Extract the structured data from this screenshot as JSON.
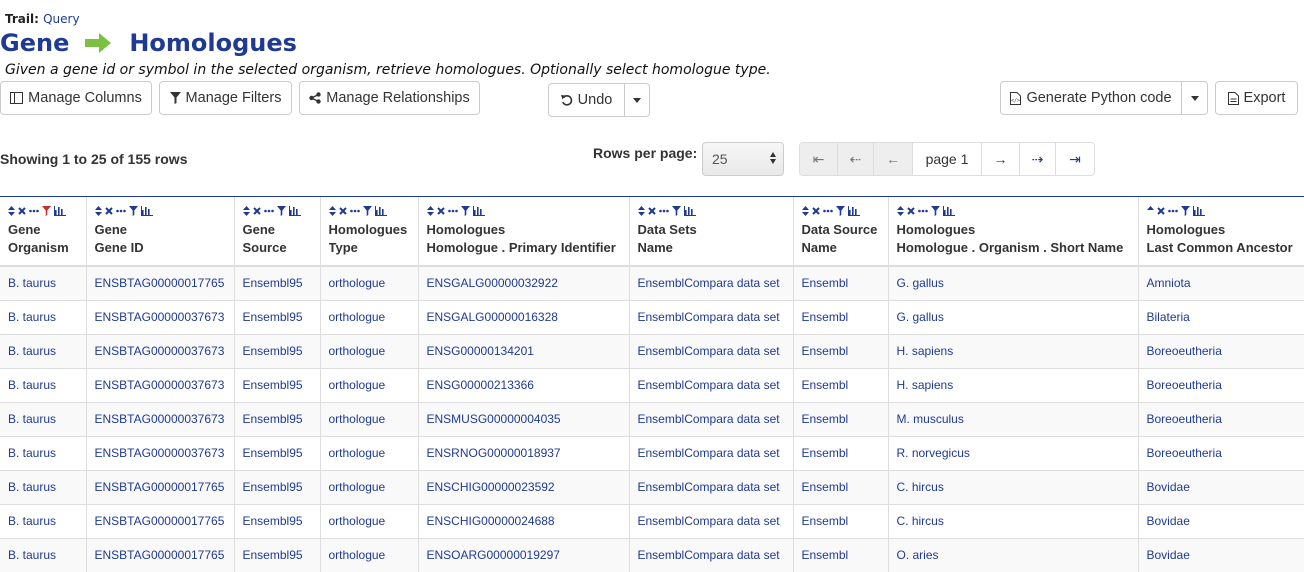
{
  "trail": {
    "label": "Trail:",
    "link": "Query"
  },
  "title": {
    "left": "Gene",
    "right": "Homologues"
  },
  "description": "Given a gene id or symbol in the selected organism, retrieve homologues. Optionally select homologue type.",
  "toolbar": {
    "manage_columns": "Manage Columns",
    "manage_filters": "Manage Filters",
    "manage_relationships": "Manage Relationships",
    "undo": "Undo",
    "generate_code": "Generate Python code",
    "export": "Export"
  },
  "showing": "Showing 1 to 25 of 155 rows",
  "rows_per_page": {
    "label": "Rows per page:",
    "value": "25"
  },
  "pager": {
    "first": "⇤",
    "prev_small": "⇠",
    "prev": "←",
    "page": "page 1",
    "next": "→",
    "next_small": "⇢",
    "last": "⇥"
  },
  "colors": {
    "accent": "#1f3a93",
    "arrow": "#7ac142",
    "filter_active": "#c9302c"
  },
  "columns": [
    {
      "line1": "Gene",
      "line2": "Organism",
      "filter_active": true,
      "sort_icon": "sort"
    },
    {
      "line1": "Gene",
      "line2": "Gene ID",
      "filter_active": false,
      "sort_icon": "sort"
    },
    {
      "line1": "Gene",
      "line2": "Source",
      "filter_active": false,
      "sort_icon": "sort"
    },
    {
      "line1": "Homologues",
      "line2": "Type",
      "filter_active": false,
      "sort_icon": "sort"
    },
    {
      "line1": "Homologues",
      "line2": "Homologue . Primary Identifier",
      "filter_active": false,
      "sort_icon": "sort"
    },
    {
      "line1": "Data Sets",
      "line2": "Name",
      "filter_active": false,
      "sort_icon": "sort"
    },
    {
      "line1": "Data Source",
      "line2": "Name",
      "filter_active": false,
      "sort_icon": "sort"
    },
    {
      "line1": "Homologues",
      "line2": "Homologue . Organism . Short Name",
      "filter_active": false,
      "sort_icon": "sort"
    },
    {
      "line1": "Homologues",
      "line2": "Last Common Ancestor",
      "filter_active": false,
      "sort_icon": "sort-asc"
    }
  ],
  "rows": [
    [
      "B. taurus",
      "ENSBTAG00000017765",
      "Ensembl95",
      "orthologue",
      "ENSGALG00000032922",
      "EnsemblCompara data set",
      "Ensembl",
      "G. gallus",
      "Amniota"
    ],
    [
      "B. taurus",
      "ENSBTAG00000037673",
      "Ensembl95",
      "orthologue",
      "ENSGALG00000016328",
      "EnsemblCompara data set",
      "Ensembl",
      "G. gallus",
      "Bilateria"
    ],
    [
      "B. taurus",
      "ENSBTAG00000037673",
      "Ensembl95",
      "orthologue",
      "ENSG00000134201",
      "EnsemblCompara data set",
      "Ensembl",
      "H. sapiens",
      "Boreoeutheria"
    ],
    [
      "B. taurus",
      "ENSBTAG00000037673",
      "Ensembl95",
      "orthologue",
      "ENSG00000213366",
      "EnsemblCompara data set",
      "Ensembl",
      "H. sapiens",
      "Boreoeutheria"
    ],
    [
      "B. taurus",
      "ENSBTAG00000037673",
      "Ensembl95",
      "orthologue",
      "ENSMUSG00000004035",
      "EnsemblCompara data set",
      "Ensembl",
      "M. musculus",
      "Boreoeutheria"
    ],
    [
      "B. taurus",
      "ENSBTAG00000037673",
      "Ensembl95",
      "orthologue",
      "ENSRNOG00000018937",
      "EnsemblCompara data set",
      "Ensembl",
      "R. norvegicus",
      "Boreoeutheria"
    ],
    [
      "B. taurus",
      "ENSBTAG00000017765",
      "Ensembl95",
      "orthologue",
      "ENSCHIG00000023592",
      "EnsemblCompara data set",
      "Ensembl",
      "C. hircus",
      "Bovidae"
    ],
    [
      "B. taurus",
      "ENSBTAG00000017765",
      "Ensembl95",
      "orthologue",
      "ENSCHIG00000024688",
      "EnsemblCompara data set",
      "Ensembl",
      "C. hircus",
      "Bovidae"
    ],
    [
      "B. taurus",
      "ENSBTAG00000017765",
      "Ensembl95",
      "orthologue",
      "ENSOARG00000019297",
      "EnsemblCompara data set",
      "Ensembl",
      "O. aries",
      "Bovidae"
    ]
  ]
}
